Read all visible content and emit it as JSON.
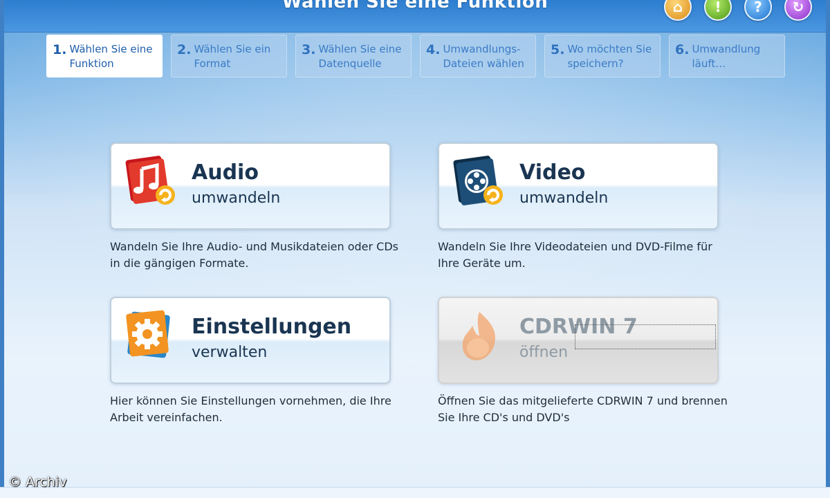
{
  "window": {
    "title": "Wählen Sie eine Funktion"
  },
  "top_icons": [
    {
      "name": "home-icon",
      "glyph": "⌂"
    },
    {
      "name": "info-icon",
      "glyph": "!"
    },
    {
      "name": "help-icon",
      "glyph": "?"
    },
    {
      "name": "update-icon",
      "glyph": "↻"
    }
  ],
  "steps": [
    {
      "num": "1.",
      "label": "Wählen Sie eine Funktion",
      "active": true
    },
    {
      "num": "2.",
      "label": "Wählen Sie ein Format",
      "active": false
    },
    {
      "num": "3.",
      "label": "Wählen Sie eine Datenquelle",
      "active": false
    },
    {
      "num": "4.",
      "label": "Umwandlungs- Dateien wählen",
      "active": false
    },
    {
      "num": "5.",
      "label": "Wo möchten Sie speichern?",
      "active": false
    },
    {
      "num": "6.",
      "label": "Umwandlung läuft…",
      "active": false
    }
  ],
  "cards": {
    "audio": {
      "title": "Audio",
      "subtitle": "umwandeln",
      "description": "Wandeln Sie Ihre Audio- und Musikdateien oder CDs in die gängigen Formate.",
      "icon": "audio-icon"
    },
    "video": {
      "title": "Video",
      "subtitle": "umwandeln",
      "description": "Wandeln Sie Ihre Videodateien und DVD-Filme für Ihre Geräte um.",
      "icon": "video-icon"
    },
    "settings": {
      "title": "Einstellungen",
      "subtitle": "verwalten",
      "description": "Hier können Sie Einstellungen vornehmen, die Ihre Arbeit vereinfachen.",
      "icon": "settings-icon"
    },
    "cdrwin": {
      "title": "CDRWIN 7",
      "subtitle": "öffnen",
      "description": "Öffnen Sie das mitgelieferte CDRWIN 7 und brennen Sie Ihre CD's und DVD's",
      "icon": "flame-icon",
      "disabled": true
    }
  },
  "watermark": "© Archiv",
  "colors": {
    "header": "#2d7ed0",
    "accent": "#2f72bf",
    "card_text": "#1a3552"
  }
}
